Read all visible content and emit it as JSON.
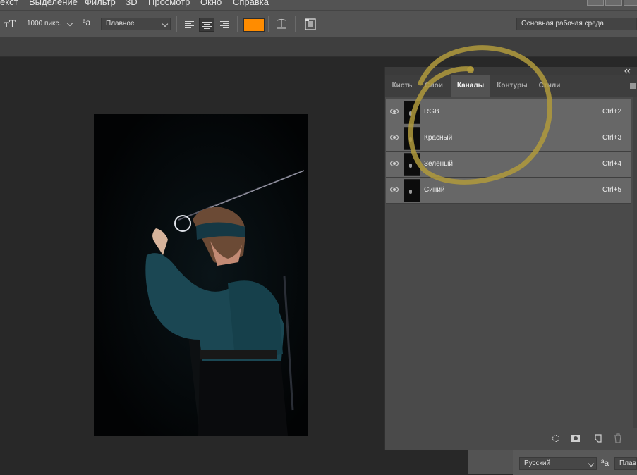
{
  "menu": {
    "items": [
      "екст",
      "Выделение",
      "Фильтр",
      "3D",
      "Просмотр",
      "Окно",
      "Справка"
    ]
  },
  "options": {
    "tool_icon": "text-tool-icon",
    "font_size": "1000 пикс.",
    "aa_glyph": "ªa",
    "antialias": "Плавное",
    "text_color": "#ff8c00",
    "workspace": "Основная рабочая среда"
  },
  "panel": {
    "tabs": [
      "Кисть",
      "Слои",
      "Каналы",
      "Контуры",
      "Стили"
    ],
    "active_tab": "Каналы",
    "channels": [
      {
        "name": "RGB",
        "shortcut": "Ctrl+2"
      },
      {
        "name": "Красный",
        "shortcut": "Ctrl+3"
      },
      {
        "name": "Зеленый",
        "shortcut": "Ctrl+4"
      },
      {
        "name": "Синий",
        "shortcut": "Ctrl+5"
      }
    ]
  },
  "bottom": {
    "language": "Русский",
    "aa_glyph": "ªa",
    "antialias_short": "Плав"
  },
  "colors": {
    "annotation": "#b09a3c",
    "accent_swatch": "#ff8c00",
    "costume": "#1d4d5a"
  }
}
